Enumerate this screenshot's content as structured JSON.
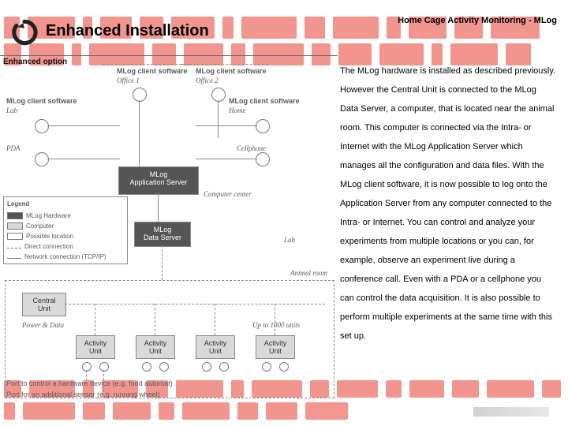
{
  "breadcrumb": "Home Cage Activity Monitoring - MLog",
  "title": "Enhanced Installation",
  "body": "The MLog hardware is installed as described previously. However the Central Unit is connected to the MLog Data Server, a computer, that is located near the animal room. This computer is connected via the Intra- or Internet with the MLog Application Server which manages all the configuration and data files. With the MLog client software, it is now possible to log onto the Application Server from any computer connected to the Intra- or Internet. You can control and analyze your experiments from multiple locations or you can, for example, observe an experiment live during a conference call. Even with a PDA or a cellphone you can control the data acquisition. It is also possible to perform multiple experiments at the same time with this set up.",
  "diagram": {
    "enhanced_option": "Enhanced option",
    "client_sw": "MLog client software",
    "office1": "Office 1",
    "office2": "Office 2",
    "lab": "Lab",
    "home": "Home",
    "pda": "PDA",
    "cellphone": "Cellphone",
    "app_server": "MLog\nApplication Server",
    "computer_center": "Computer center",
    "data_server": "MLog\nData Server",
    "lab_room": "Lab",
    "animal_room": "Animal room",
    "central_unit": "Central\nUnit",
    "power_data": "Power & Data",
    "up_to_units": "Up to 1000 units",
    "activity_unit": "Activity\nUnit",
    "port_control": "Port to control a hardware device (e.g. food automat)",
    "port_sensor": "Port for an additional sensor (e.g. running wheel)"
  },
  "legend": {
    "title": "Legend",
    "hw": "MLog Hardware",
    "computer": "Computer",
    "loc": "Possible location",
    "direct": "Direct connection",
    "net": "Network connection (TCP/IP)"
  }
}
